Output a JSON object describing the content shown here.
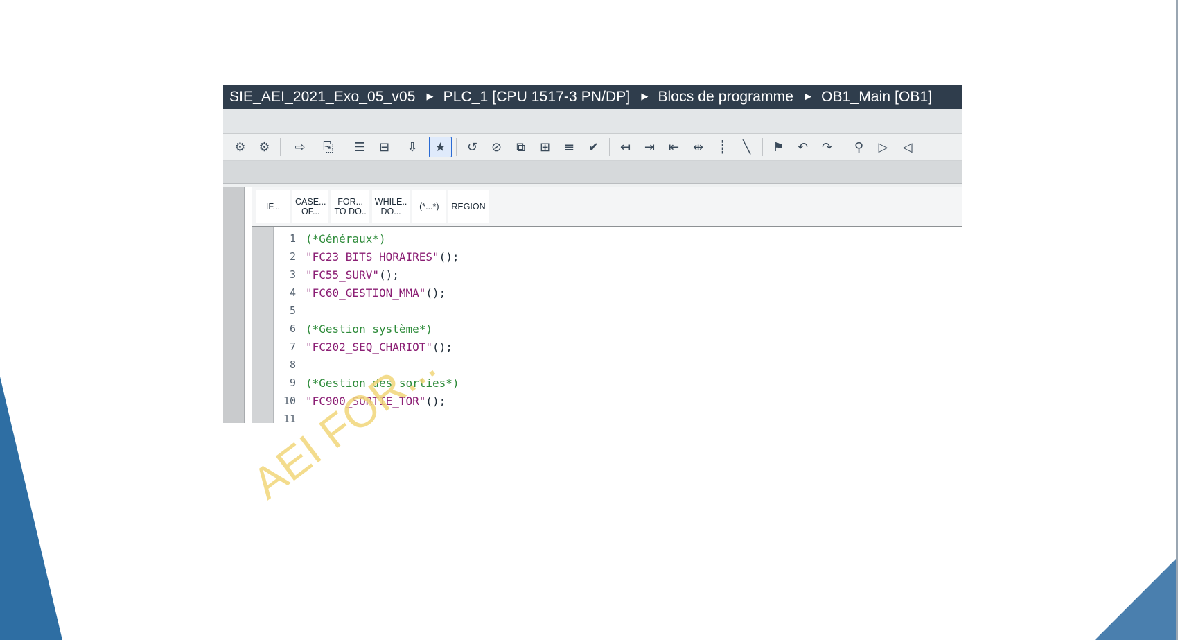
{
  "breadcrumb": {
    "items": [
      "SIE_AEI_2021_Exo_05_v05",
      "PLC_1 [CPU 1517-3 PN/DP]",
      "Blocs de programme",
      "OB1_Main [OB1]"
    ]
  },
  "toolbar": {
    "icons": [
      "insert-network-icon",
      "delete-network-icon",
      "download-to-device-icon",
      "monitor-icon",
      "indent-icon",
      "outdent-icon",
      "compile-download-icon",
      "highlight-icon",
      "delete-bookmark-icon",
      "clear-breakpoint-icon",
      "copy-icon",
      "paste-icon",
      "list-icon",
      "check-icon",
      "go-to-icon",
      "indent-more-icon",
      "indent-less-icon",
      "align-icon",
      "comment-icon",
      "uncomment-icon",
      "bookmark-icon",
      "prev-bookmark-icon",
      "next-bookmark-icon",
      "find-icon",
      "monitor-on-icon",
      "monitor-off-icon"
    ]
  },
  "snippets": [
    "IF...",
    "CASE...\nOF...",
    "FOR...\nTO DO..",
    "WHILE..\nDO...",
    "(*...*)",
    "REGION"
  ],
  "code": [
    {
      "n": "1",
      "parts": [
        {
          "t": "(*Généraux*)",
          "c": "cm"
        }
      ]
    },
    {
      "n": "2",
      "parts": [
        {
          "t": "\"FC23_BITS_HORAIRES\"",
          "c": "str"
        },
        {
          "t": "();",
          "c": "pn"
        }
      ]
    },
    {
      "n": "3",
      "parts": [
        {
          "t": "\"FC55_SURV\"",
          "c": "str"
        },
        {
          "t": "();",
          "c": "pn"
        }
      ]
    },
    {
      "n": "4",
      "parts": [
        {
          "t": "\"FC60_GESTION_MMA\"",
          "c": "str"
        },
        {
          "t": "();",
          "c": "pn"
        }
      ]
    },
    {
      "n": "5",
      "parts": []
    },
    {
      "n": "6",
      "parts": [
        {
          "t": "(*Gestion système*)",
          "c": "cm"
        }
      ]
    },
    {
      "n": "7",
      "parts": [
        {
          "t": "\"FC202_SEQ_CHARIOT\"",
          "c": "str"
        },
        {
          "t": "();",
          "c": "pn"
        }
      ]
    },
    {
      "n": "8",
      "parts": []
    },
    {
      "n": "9",
      "parts": [
        {
          "t": "(*Gestion des sorties*)",
          "c": "cm"
        }
      ]
    },
    {
      "n": "10",
      "parts": [
        {
          "t": "\"FC900_SORTIE_TOR\"",
          "c": "str"
        },
        {
          "t": "();",
          "c": "pn"
        }
      ]
    },
    {
      "n": "11",
      "parts": []
    }
  ],
  "watermark": "AEI FOR...",
  "colors": {
    "breadcrumb_bg": "#2f3d4c",
    "comment": "#2e8b3a",
    "string": "#8b1e74",
    "deco_blue": "#2e6ea3"
  }
}
